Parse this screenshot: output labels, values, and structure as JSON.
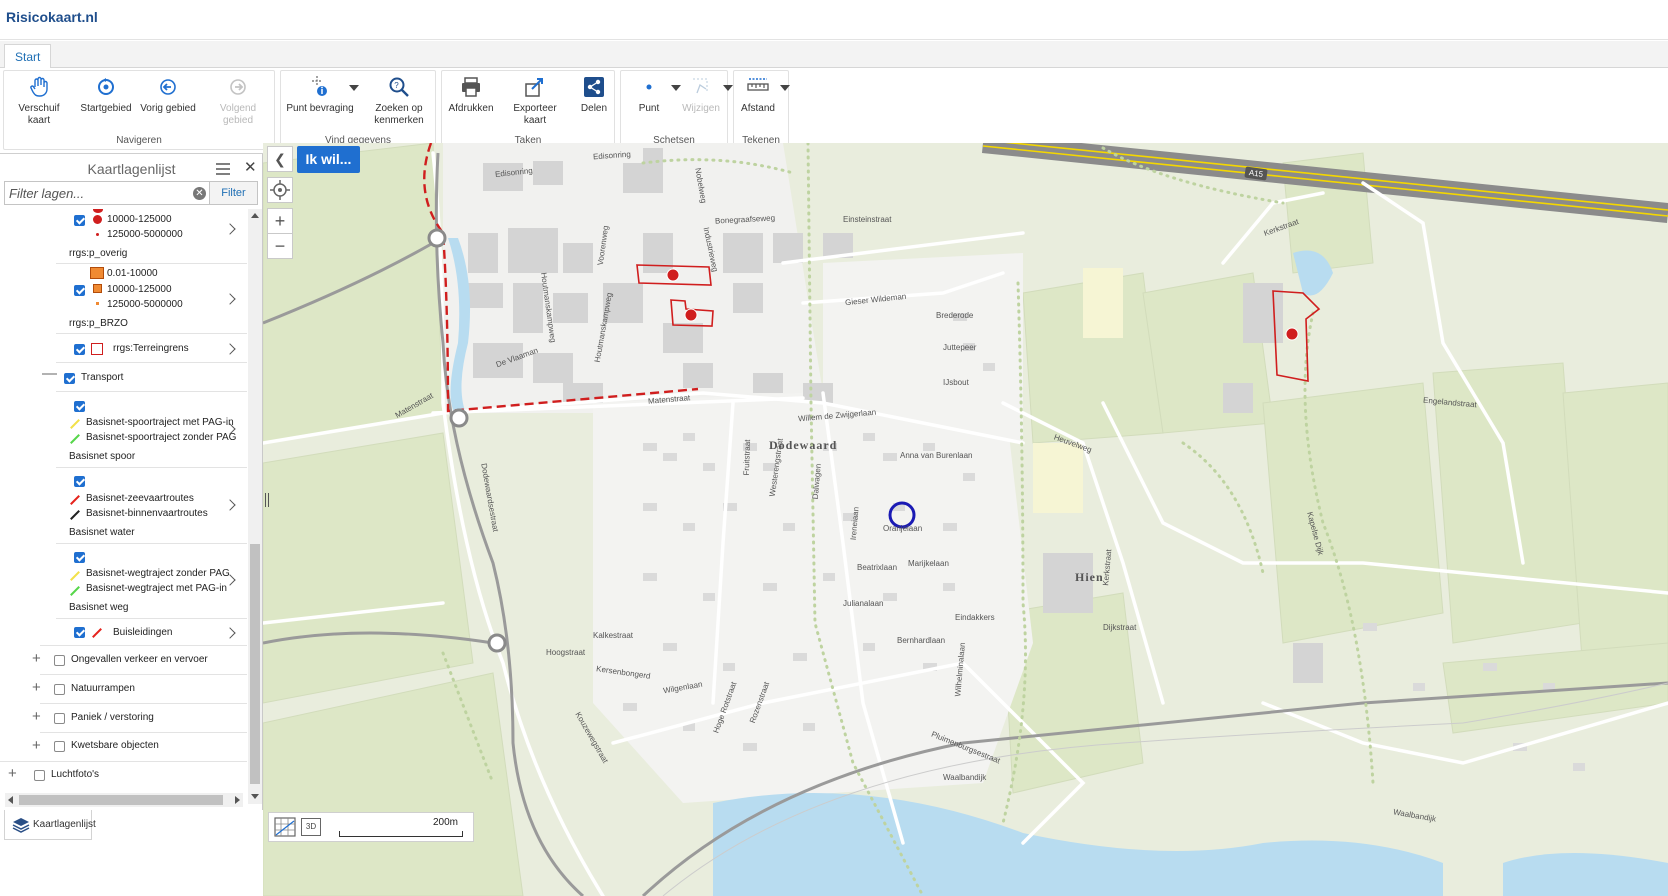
{
  "app": {
    "title": "Risicokaart.nl"
  },
  "ribbon": {
    "tabs": [
      {
        "label": "Start"
      }
    ],
    "groups": {
      "navigeren": {
        "label": "Navigeren",
        "buttons": [
          {
            "label": "Verschuif kaart",
            "icon": "hand-icon"
          },
          {
            "label": "Startgebied",
            "icon": "home-extent-icon"
          },
          {
            "label": "Vorig gebied",
            "icon": "previous-extent-icon"
          },
          {
            "label": "Volgend gebied",
            "icon": "next-extent-icon",
            "disabled": true
          }
        ]
      },
      "vind_gegevens": {
        "label": "Vind gegevens",
        "buttons": [
          {
            "label": "Punt bevraging",
            "icon": "point-query-icon"
          },
          {
            "label": "Zoeken op kenmerken",
            "icon": "search-attributes-icon"
          }
        ]
      },
      "taken": {
        "label": "Taken",
        "buttons": [
          {
            "label": "Afdrukken",
            "icon": "print-icon"
          },
          {
            "label": "Exporteer kaart",
            "icon": "export-icon"
          },
          {
            "label": "Delen",
            "icon": "share-icon"
          }
        ]
      },
      "schetsen": {
        "label": "Schetsen",
        "buttons": [
          {
            "label": "Punt",
            "icon": "sketch-point-icon"
          },
          {
            "label": "Wijzigen",
            "icon": "edit-sketch-icon",
            "disabled": true
          }
        ]
      },
      "tekenen": {
        "label": "Tekenen",
        "buttons": [
          {
            "label": "Afstand",
            "icon": "measure-distance-icon"
          }
        ]
      }
    }
  },
  "layer_panel": {
    "title": "Kaartlagenlijst",
    "filter": {
      "placeholder": "Filter lagen...",
      "button": "Filter"
    },
    "tree": {
      "rrgs_vuurwerk_legend": [
        "10000-125000",
        "125000-5000000"
      ],
      "rrgs_p_overig": {
        "name": "rrgs:p_overig",
        "legend": [
          "0.01-10000",
          "10000-125000",
          "125000-5000000"
        ]
      },
      "rrgs_p_brzo": {
        "name": "rrgs:p_BRZO"
      },
      "terreingrens": {
        "name": "rrgs:Terreingrens"
      },
      "transport": {
        "name": "Transport"
      },
      "basisnet_spoor": {
        "name": "Basisnet spoor",
        "legend": [
          "Basisnet-spoortraject met PAG-in",
          "Basisnet-spoortraject zonder PAG"
        ]
      },
      "basisnet_water": {
        "name": "Basisnet water",
        "legend": [
          "Basisnet-zeevaartroutes",
          "Basisnet-binnenvaartroutes"
        ]
      },
      "basisnet_weg": {
        "name": "Basisnet weg",
        "legend": [
          "Basisnet-wegtraject zonder PAG",
          "Basisnet-wegtraject met PAG-in"
        ]
      },
      "buisleidingen": {
        "name": "Buisleidingen"
      },
      "groups": [
        "Ongevallen verkeer en vervoer",
        "Natuurrampen",
        "Paniek / verstoring",
        "Kwetsbare objecten"
      ],
      "luchtfotos": "Luchtfoto's"
    },
    "footer_tab": "Kaartlagenlijst"
  },
  "map": {
    "ik_wil": "Ik wil...",
    "scale_label": "200m",
    "view_3d_label": "3D",
    "highway_shield": "A15",
    "place_labels": [
      "Dodewaard",
      "Hien"
    ],
    "street_labels": [
      "Edisonring",
      "Edisonring",
      "Bonegraafseweg",
      "Einsteinstraat",
      "Industrieweg",
      "Nobelweg",
      "Voorenweg",
      "Houtmanskampweg",
      "Houtmanskampweg",
      "De Vlaaman",
      "Matenstraat",
      "Matenstraat",
      "Dodewaardsestraat",
      "Gieser Wildeman",
      "Brederode",
      "Juttepeer",
      "IJsbout",
      "Willem de Zwijgerlaan",
      "Anna van Burenlaan",
      "Westerengstraat",
      "Fruitstraat",
      "Oranjelaan",
      "Beatrixlaan",
      "Marijkelaan",
      "Julianalaan",
      "Bernhardlaan",
      "Eindakkers",
      "Kalkestraat",
      "Kersenbongerd",
      "Wilgenlaan",
      "Hoge Rotstraat",
      "Rozenstraat",
      "Pluimenburgsestraat",
      "Waalbandijk",
      "Waalbandijk",
      "Kerkstraat",
      "Kerkstraat",
      "Engelandstraat",
      "Heuvelweg",
      "Kapelse Dijk",
      "Dalwagen",
      "Wilhelminalaan",
      "Kouzewegstraat",
      "Hoogstraat",
      "Ireneiaan",
      "Dijkstraat"
    ],
    "colors": {
      "risk_red": "#d01e1e",
      "route_blue": "#1a1ab4",
      "brand_blue": "#1f6fd0",
      "highway_yellow": "#f4d700"
    }
  }
}
